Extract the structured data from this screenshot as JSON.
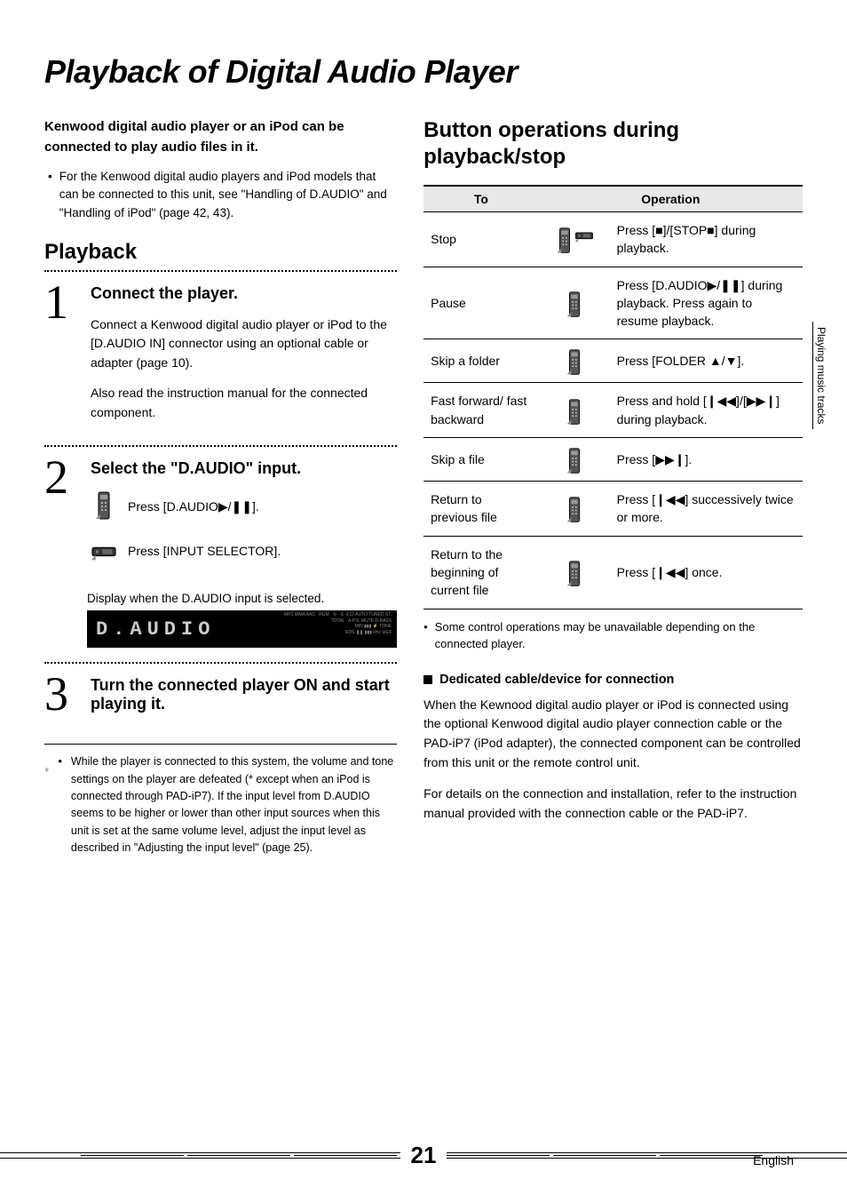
{
  "page_title": "Playback of Digital Audio Player",
  "intro_bold": "Kenwood digital audio player or an iPod can be connected to play audio files in it.",
  "intro_bullet": "For the Kenwood digital audio players and iPod models that can be connected to this unit, see \"Handling of D.AUDIO\" and \"Handling of iPod\" (page 42, 43).",
  "left": {
    "heading": "Playback",
    "steps": [
      {
        "num": "1",
        "title": "Connect the player.",
        "para1": "Connect a Kenwood digital audio player or iPod to the [D.AUDIO IN] connector using an optional cable or adapter (page 10).",
        "para2": "Also read the instruction manual for the connected component."
      },
      {
        "num": "2",
        "title": "Select the \"D.AUDIO\" input.",
        "remote_line": "Press [D.AUDIO▶/❚❚].",
        "unit_line": "Press [INPUT SELECTOR].",
        "display_caption": "Display when the D.AUDIO input is selected.",
        "display_text": "D.AUDIO"
      },
      {
        "num": "3",
        "title": "Turn the connected player ON and start playing it."
      }
    ],
    "tip": "While the player is connected to this system, the volume and tone settings on the player are defeated (* except when an iPod is connected through PAD-iP7). If the input level from D.AUDIO seems to be higher or lower than other input sources when this unit is set at the same volume level, adjust the input level as described in \"Adjusting the input level\" (page 25)."
  },
  "right": {
    "heading": "Button operations during playback/stop",
    "table": {
      "headers": [
        "To",
        "Operation"
      ],
      "rows": [
        {
          "to": "Stop",
          "icons": [
            "remote",
            "unit"
          ],
          "op": "Press [■]/[STOP■] during playback."
        },
        {
          "to": "Pause",
          "icons": [
            "remote"
          ],
          "op": "Press [D.AUDIO▶/❚❚] during playback. Press again to resume playback."
        },
        {
          "to": "Skip a folder",
          "icons": [
            "remote"
          ],
          "op": "Press [FOLDER ▲/▼]."
        },
        {
          "to": "Fast forward/ fast backward",
          "icons": [
            "remote"
          ],
          "op": "Press and hold [❙◀◀]/[▶▶❙] during playback."
        },
        {
          "to": "Skip a file",
          "icons": [
            "remote"
          ],
          "op": "Press [▶▶❙]."
        },
        {
          "to": "Return to previous file",
          "icons": [
            "remote"
          ],
          "op": "Press [❙◀◀] successively twice or more."
        },
        {
          "to": "Return to the beginning of current file",
          "icons": [
            "remote"
          ],
          "op": "Press [❙◀◀] once."
        }
      ]
    },
    "note": "Some control operations may be unavailable depending on the connected player.",
    "sub_heading": "Dedicated cable/device for connection",
    "para1": "When the Kewnood digital audio player or iPod is connected using the optional Kenwood digital audio player connection cable or the PAD-iP7 (iPod adapter), the connected component can be controlled from this unit or the remote control unit.",
    "para2": "For details on the connection and installation, refer to the instruction manual provided with the connection cable or the PAD-iP7."
  },
  "side_tab": "Playing music tracks",
  "footer": {
    "page": "21",
    "lang": "English"
  }
}
